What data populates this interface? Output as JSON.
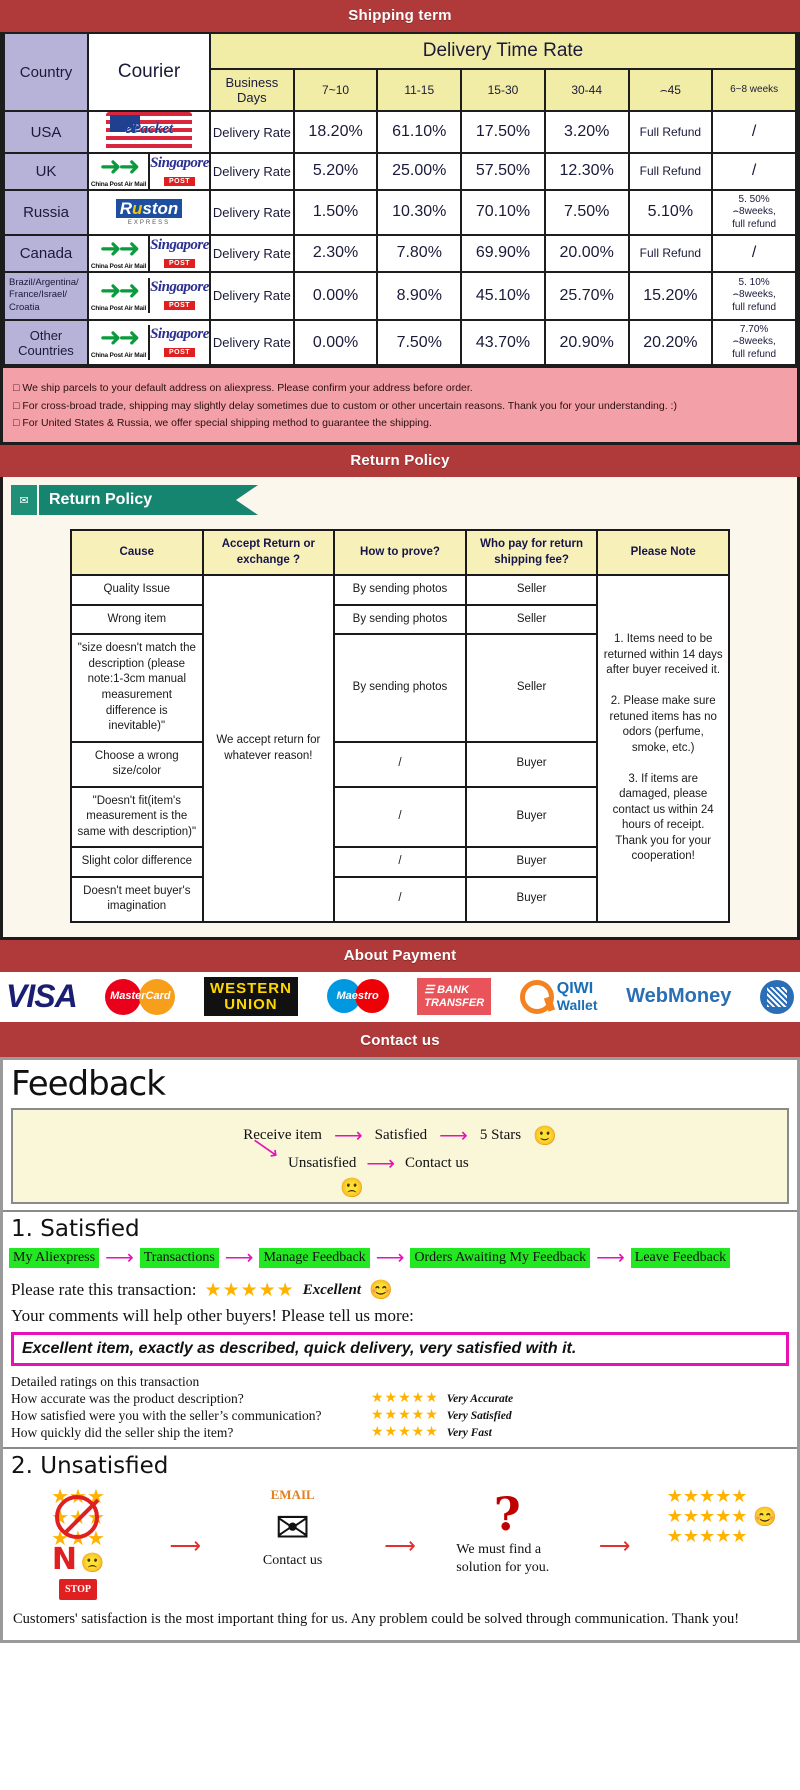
{
  "banners": {
    "shipping": "Shipping term",
    "return": "Return Policy",
    "payment": "About Payment",
    "contact": "Contact us"
  },
  "shipping": {
    "headers": {
      "country": "Country",
      "courier": "Courier",
      "delivery_time_rate": "Delivery Time Rate",
      "business_days": "Business Days",
      "cols": [
        "7~10",
        "11-15",
        "15-30",
        "30-44",
        "⌢45",
        "6~8 weeks"
      ]
    },
    "rate_label": "Delivery Rate",
    "rows": [
      {
        "country": "USA",
        "couriers": [
          "epacket"
        ],
        "values": [
          "18.20%",
          "61.10%",
          "17.50%",
          "3.20%",
          "Full Refund",
          "/"
        ]
      },
      {
        "country": "UK",
        "couriers": [
          "china-post-air-mail",
          "singapore-post"
        ],
        "values": [
          "5.20%",
          "25.00%",
          "57.50%",
          "12.30%",
          "Full Refund",
          "/"
        ]
      },
      {
        "country": "Russia",
        "couriers": [
          "ruston-express"
        ],
        "values": [
          "1.50%",
          "10.30%",
          "70.10%",
          "7.50%",
          "5.10%",
          "5. 50%\n⌢8weeks,\nfull refund"
        ]
      },
      {
        "country": "Canada",
        "couriers": [
          "china-post-air-mail",
          "singapore-post"
        ],
        "values": [
          "2.30%",
          "7.80%",
          "69.90%",
          "20.00%",
          "Full Refund",
          "/"
        ]
      },
      {
        "country": "Brazil/Argentina/ France/Israel/ Croatia",
        "couriers": [
          "china-post-air-mail",
          "singapore-post"
        ],
        "values": [
          "0.00%",
          "8.90%",
          "45.10%",
          "25.70%",
          "15.20%",
          "5. 10%\n⌢8weeks,\nfull refund"
        ]
      },
      {
        "country": "Other Countries",
        "couriers": [
          "china-post-air-mail",
          "singapore-post"
        ],
        "values": [
          "0.00%",
          "7.50%",
          "43.70%",
          "20.90%",
          "20.20%",
          "7.70%\n⌢8weeks,\nfull refund"
        ]
      }
    ],
    "notes": [
      "We ship parcels to your default address on aliexpress. Please confirm your address before order.",
      "For cross-broad trade, shipping may slightly delay sometimes due to custom or other uncertain reasons. Thank you for your understanding. :)",
      "For United States & Russia, we offer special shipping method to guarantee the shipping."
    ]
  },
  "return_policy": {
    "tab_label": "Return Policy",
    "headers": [
      "Cause",
      "Accept Return or exchange ?",
      "How to prove?",
      "Who pay for return shipping fee?",
      "Please Note"
    ],
    "accept_text": "We accept return for whatever reason!",
    "rows": [
      {
        "cause": "Quality Issue",
        "prove": "By sending photos",
        "who": "Seller"
      },
      {
        "cause": "Wrong item",
        "prove": "By sending photos",
        "who": "Seller"
      },
      {
        "cause": "\"size doesn't match the description (please note:1-3cm manual measurement difference is inevitable)\"",
        "prove": "By sending photos",
        "who": "Seller"
      },
      {
        "cause": "Choose a wrong size/color",
        "prove": "/",
        "who": "Buyer"
      },
      {
        "cause": "\"Doesn't fit(item's measurement is the same with description)\"",
        "prove": "/",
        "who": "Buyer"
      },
      {
        "cause": "Slight color difference",
        "prove": "/",
        "who": "Buyer"
      },
      {
        "cause": "Doesn't meet buyer's imagination",
        "prove": "/",
        "who": "Buyer"
      }
    ],
    "note": "1. Items need to be returned within 14 days after buyer received it.\n\n2. Please make sure retuned items has no odors (perfume, smoke, etc.)\n\n3. If items are damaged, please contact us within 24 hours of receipt.\nThank you for your cooperation!"
  },
  "payment": {
    "methods": [
      {
        "name": "visa",
        "label": "VISA"
      },
      {
        "name": "mastercard",
        "label": "MasterCard"
      },
      {
        "name": "western-union",
        "label1": "WESTERN",
        "label2": "UNION"
      },
      {
        "name": "maestro",
        "label": "Maestro"
      },
      {
        "name": "bank-transfer",
        "label1": "BANK",
        "label2": "TRANSFER"
      },
      {
        "name": "qiwi-wallet",
        "label1": "QIWI",
        "label2": "Wallet"
      },
      {
        "name": "webmoney",
        "label": "WebMoney"
      },
      {
        "name": "wmz",
        "label": ""
      }
    ]
  },
  "feedback": {
    "title": "Feedback",
    "flow": {
      "receive_item": "Receive item",
      "satisfied": "Satisfied",
      "five_stars": "5 Stars",
      "unsatisfied": "Unsatisfied",
      "contact_us": "Contact us",
      "happy_face": "🙂",
      "sad_face": "🙁"
    },
    "satisfied": {
      "heading": "1. Satisfied",
      "steps": [
        "My Aliexpress",
        "Transactions",
        "Manage Feedback",
        "Orders Awaiting My Feedback",
        "Leave Feedback"
      ],
      "rate_label": "Please rate this transaction:",
      "stars": "★★★★★",
      "rate_word": "Excellent",
      "rate_emoji": "😊",
      "comments_label": "Your comments will help other buyers! Please tell us more:",
      "comment_text": "Excellent item, exactly as described, quick delivery, very satisfied with it.",
      "detailed_label": "Detailed ratings on this transaction",
      "detailed": [
        {
          "q": "How accurate was the product description?",
          "stars": "★★★★★",
          "value": "Very Accurate"
        },
        {
          "q": "How satisfied were you with the seller’s communication?",
          "stars": "★★★★★",
          "value": "Very Satisfied"
        },
        {
          "q": "How quickly did the seller ship the item?",
          "stars": "★★★★★",
          "value": "Very Fast"
        }
      ]
    },
    "unsatisfied": {
      "heading": "2. Unsatisfied",
      "no_text": "N",
      "stop_text": "STOP",
      "email_text": "EMAIL",
      "contact_us": "Contact us",
      "must_find": "We must find a solution for you.",
      "closing": "Customers' satisfaction is the most important thing for us. Any problem could be solved through communication. Thank you!"
    }
  },
  "colors": {
    "banner_red": "#b03a3a",
    "header_yellow": "#f2eda6",
    "country_purple": "#b7b3d8",
    "note_pink": "#f4a0a8",
    "teal": "#16856f",
    "green_chip": "#22e822",
    "magenta": "#e612b8",
    "star_gold": "#ffb300"
  }
}
